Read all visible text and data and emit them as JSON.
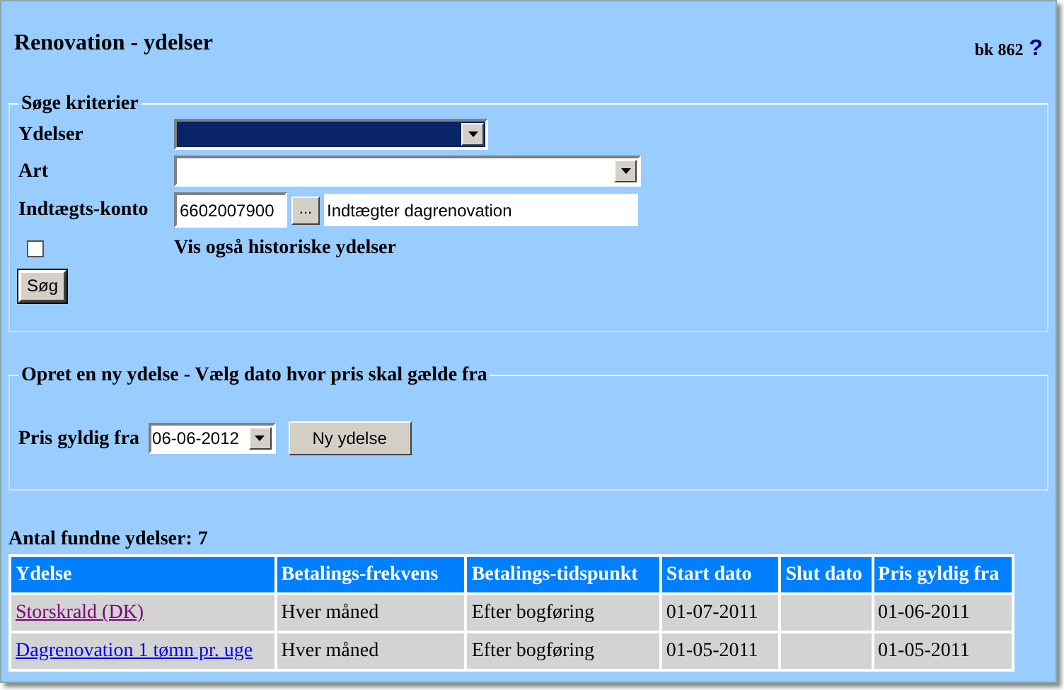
{
  "header": {
    "title": "Renovation - ydelser",
    "code": "bk 862",
    "help": "?"
  },
  "search": {
    "legend": "Søge kriterier",
    "fields": [
      {
        "label": "Ydelser",
        "kind": "short_select",
        "focused": true
      },
      {
        "label": "Art",
        "kind": "select",
        "focused": false
      },
      {
        "label": "Indtægts-konto",
        "kind": "account",
        "value": "6602007900",
        "lookup": "...",
        "description": "Indtægter dagrenovation"
      }
    ],
    "checkbox": {
      "label": "Vis også historiske ydelser",
      "checked": false
    },
    "button": "Søg"
  },
  "create": {
    "legend": "Opret en ny ydelse - Vælg dato hvor pris skal gælde fra",
    "label": "Pris gyldig fra",
    "date": "06-06-2012",
    "button": "Ny ydelse"
  },
  "results": {
    "count_label": "Antal fundne ydelser:",
    "count": "7",
    "columns": [
      "Ydelse",
      "Betalings-frekvens",
      "Betalings-tidspunkt",
      "Start dato",
      "Slut dato",
      "Pris gyldig fra"
    ],
    "rows": [
      {
        "visited": true,
        "cells": [
          "Storskrald (DK)",
          "Hver måned",
          "Efter bogføring",
          "01-07-2011",
          "",
          "01-06-2011"
        ]
      },
      {
        "visited": false,
        "cells": [
          "Dagrenovation 1 tømn pr. uge",
          "Hver måned",
          "Efter bogføring",
          "01-05-2011",
          "",
          "01-05-2011"
        ]
      }
    ]
  }
}
